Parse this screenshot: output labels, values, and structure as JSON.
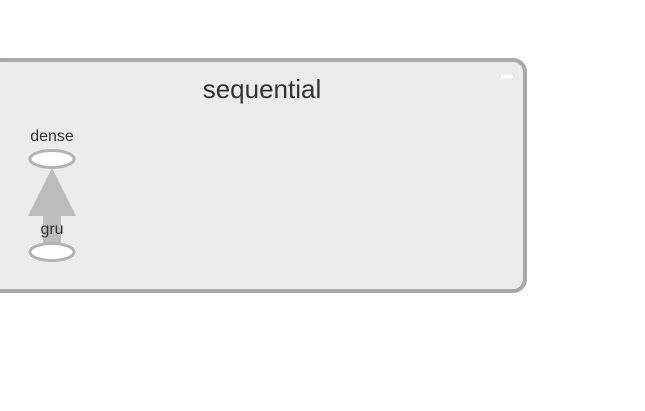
{
  "group": {
    "title": "sequential",
    "collapse_symbol": "minus-icon"
  },
  "nodes": [
    {
      "id": "dense",
      "label": "dense"
    },
    {
      "id": "gru",
      "label": "gru"
    }
  ],
  "edges": [
    {
      "from": "gru",
      "to": "dense"
    }
  ],
  "colors": {
    "group_fill": "#ececec",
    "group_stroke": "#a8a8a8",
    "node_fill": "#ffffff",
    "node_stroke": "#b3b3b3",
    "edge": "#bdbdbd",
    "text": "#333333"
  }
}
